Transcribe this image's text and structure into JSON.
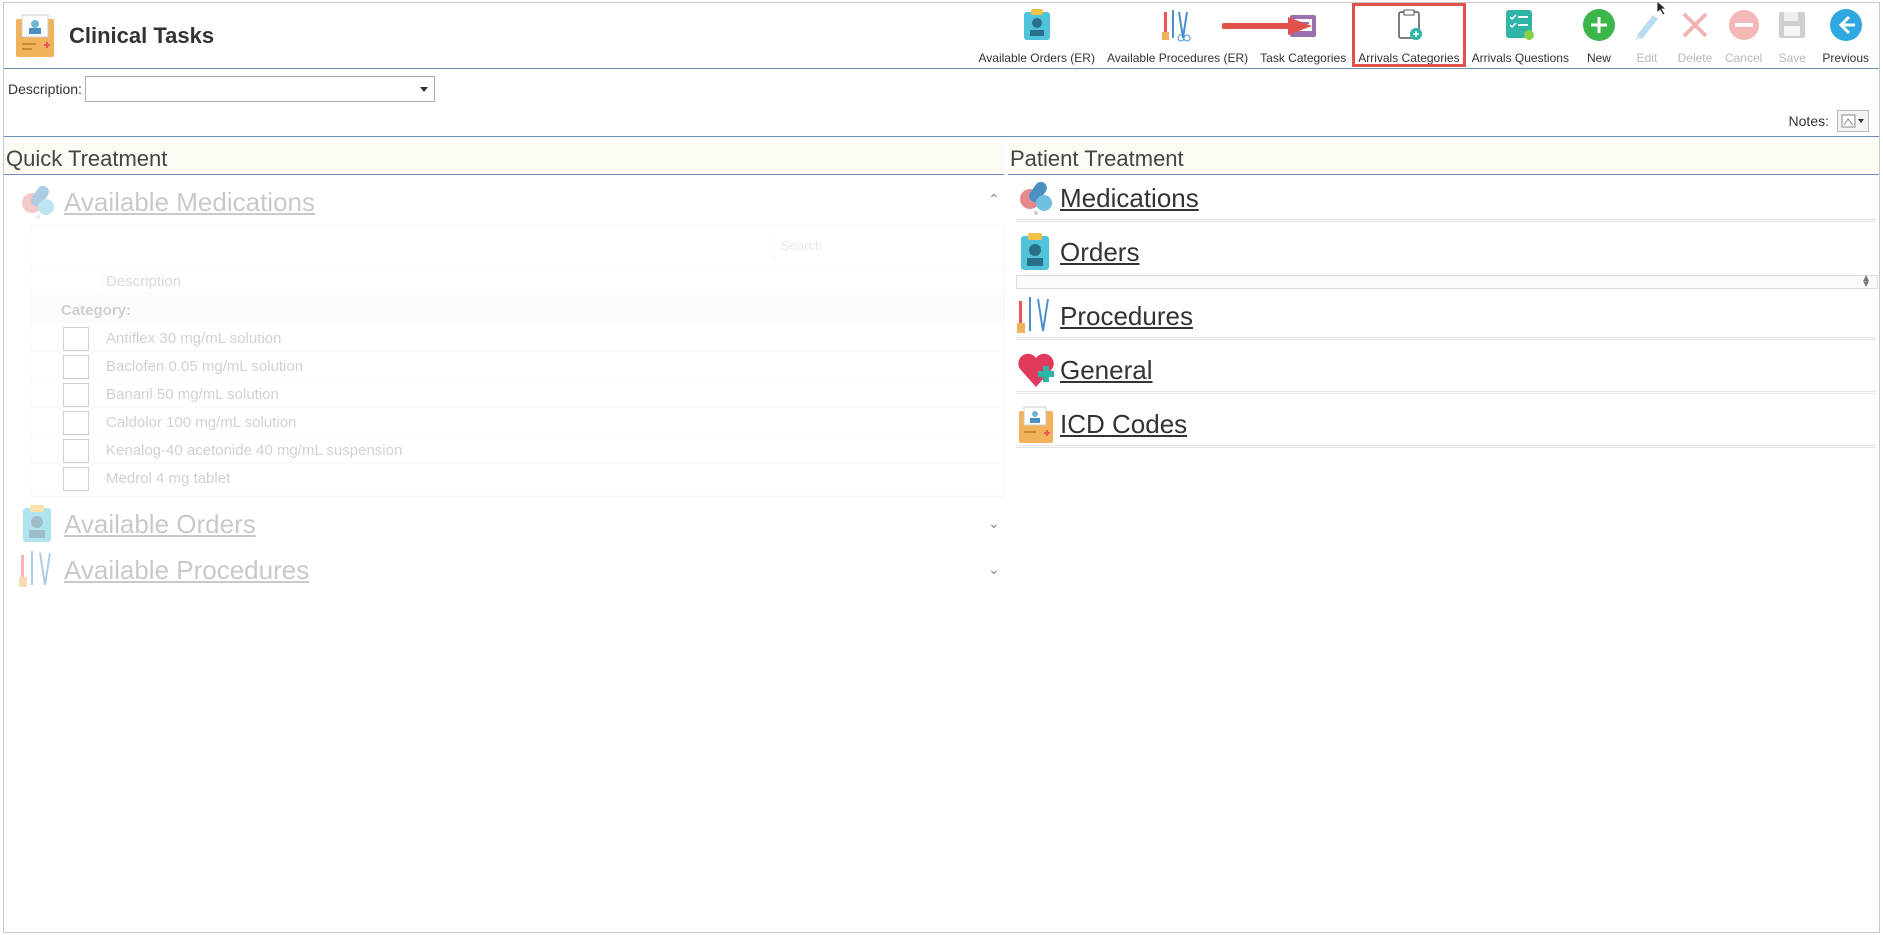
{
  "header": {
    "title": "Clinical Tasks",
    "toolbar": [
      {
        "label": "Available Orders (ER)",
        "icon": "orders-icon",
        "enabled": true
      },
      {
        "label": "Available Procedures (ER)",
        "icon": "procedures-icon",
        "enabled": true
      },
      {
        "label": "Task Categories",
        "icon": "task-categories-icon",
        "enabled": true
      },
      {
        "label": "Arrivals Categories",
        "icon": "arrivals-categories-icon",
        "enabled": true,
        "highlighted": true
      },
      {
        "label": "Arrivals Questions",
        "icon": "arrivals-questions-icon",
        "enabled": true
      },
      {
        "label": "New",
        "icon": "plus-icon",
        "enabled": true
      },
      {
        "label": "Edit",
        "icon": "pencil-icon",
        "enabled": false
      },
      {
        "label": "Delete",
        "icon": "x-icon",
        "enabled": false
      },
      {
        "label": "Cancel",
        "icon": "cancel-icon",
        "enabled": false
      },
      {
        "label": "Save",
        "icon": "save-icon",
        "enabled": false
      },
      {
        "label": "Previous",
        "icon": "back-arrow-icon",
        "enabled": true
      }
    ]
  },
  "description": {
    "label": "Description:",
    "value": ""
  },
  "notes": {
    "label": "Notes:"
  },
  "quick_treatment": {
    "title": "Quick Treatment",
    "medications": {
      "title": "Available Medications",
      "search_placeholder": "Search",
      "column": "Description",
      "category_label": "Category:",
      "items": [
        "Antiflex 30 mg/mL solution",
        "Baclofen 0.05 mg/mL solution",
        "Banaril 50 mg/mL solution",
        "Caldolor 100 mg/mL solution",
        "Kenalog-40 acetonide 40 mg/mL suspension",
        "Medrol 4 mg tablet"
      ]
    },
    "orders": {
      "title": "Available Orders"
    },
    "procedures": {
      "title": "Available Procedures"
    }
  },
  "patient_treatment": {
    "title": "Patient Treatment",
    "items": [
      "Medications",
      "Orders",
      "Procedures",
      "General",
      "ICD Codes"
    ]
  },
  "colors": {
    "accent_line": "#6e8fb5",
    "highlight": "#e0524a",
    "new_green": "#3cb54a",
    "previous_blue": "#2fa8e0"
  }
}
